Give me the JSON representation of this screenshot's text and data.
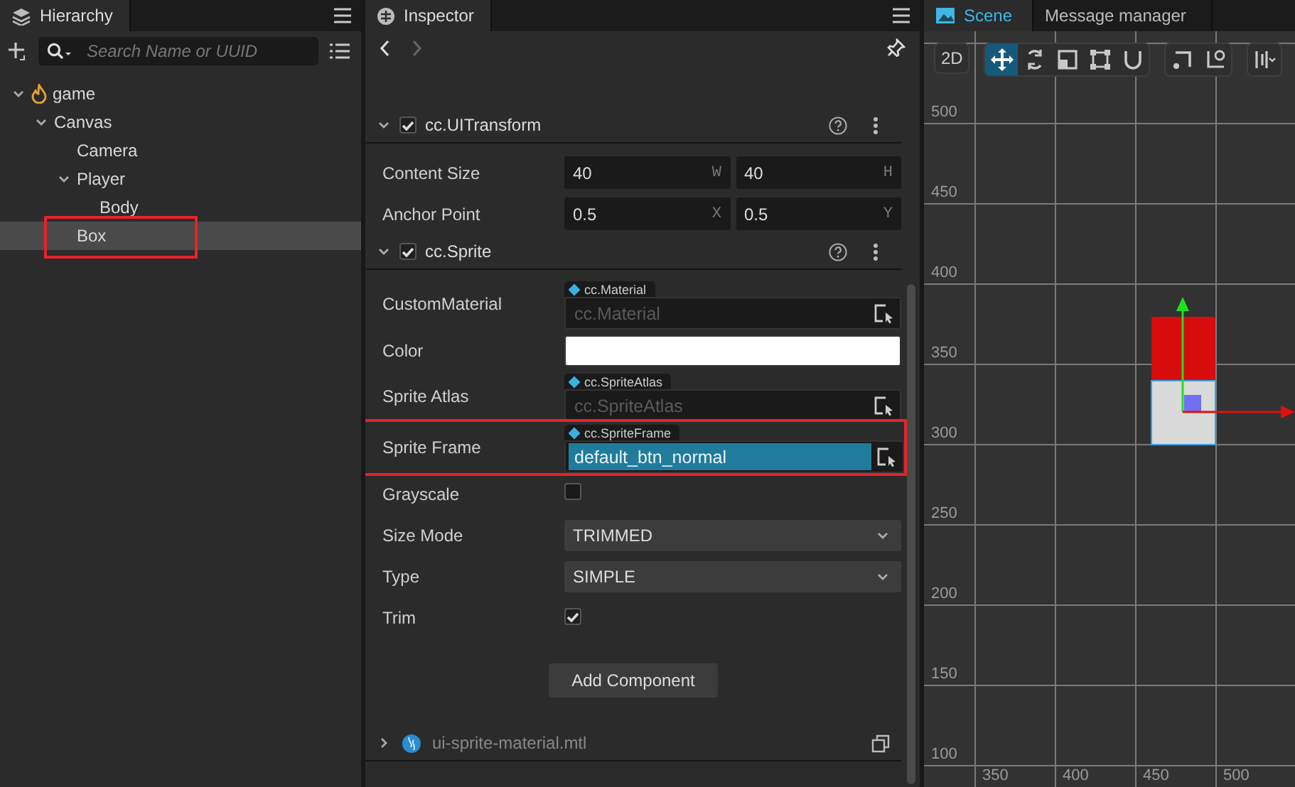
{
  "hierarchy": {
    "tab": "Hierarchy",
    "search": {
      "placeholder": "Search Name or UUID"
    },
    "tree": [
      {
        "name": "game",
        "kind": "scene",
        "expanded": true,
        "selected": false,
        "highlighted": false,
        "children": [
          {
            "name": "Canvas",
            "expanded": true,
            "selected": false,
            "highlighted": false,
            "children": [
              {
                "name": "Camera",
                "selected": false,
                "highlighted": false
              },
              {
                "name": "Player",
                "expanded": true,
                "selected": false,
                "highlighted": false,
                "children": [
                  {
                    "name": "Body",
                    "selected": false,
                    "highlighted": false
                  }
                ]
              },
              {
                "name": "Box",
                "selected": true,
                "highlighted": true
              }
            ]
          }
        ]
      }
    ]
  },
  "inspector": {
    "tab": "Inspector",
    "components": [
      {
        "name": "cc.UITransform",
        "enabled": true,
        "expanded": true,
        "properties": [
          {
            "label": "Content Size",
            "kind": "vec2",
            "highlighted": false,
            "fields": [
              {
                "value": "40",
                "axis": "W"
              },
              {
                "value": "40",
                "axis": "H"
              }
            ]
          },
          {
            "label": "Anchor Point",
            "kind": "vec2",
            "highlighted": false,
            "fields": [
              {
                "value": "0.5",
                "axis": "X"
              },
              {
                "value": "0.5",
                "axis": "Y"
              }
            ]
          }
        ]
      },
      {
        "name": "cc.Sprite",
        "enabled": true,
        "expanded": true,
        "properties": [
          {
            "label": "CustomMaterial",
            "kind": "asset",
            "highlighted": false,
            "type": "cc.Material",
            "placeholder": "cc.Material"
          },
          {
            "label": "Color",
            "kind": "color",
            "highlighted": false,
            "color": "#ffffff"
          },
          {
            "label": "Sprite Atlas",
            "kind": "asset",
            "highlighted": false,
            "type": "cc.SpriteAtlas",
            "placeholder": "cc.SpriteAtlas"
          },
          {
            "label": "Sprite Frame",
            "kind": "asset",
            "highlighted": true,
            "type": "cc.SpriteFrame",
            "value": "default_btn_normal"
          },
          {
            "label": "Grayscale",
            "kind": "checkbox",
            "highlighted": false,
            "checked": false
          },
          {
            "label": "Size Mode",
            "kind": "select",
            "highlighted": false,
            "value": "TRIMMED"
          },
          {
            "label": "Type",
            "kind": "select",
            "highlighted": false,
            "value": "SIMPLE"
          },
          {
            "label": "Trim",
            "kind": "checkbox",
            "highlighted": false,
            "checked": true
          }
        ]
      }
    ],
    "add_button": "Add Component",
    "material": {
      "name": "ui-sprite-material.mtl",
      "expanded": false
    }
  },
  "scene": {
    "tabs": [
      {
        "label": "Scene",
        "selected": true
      },
      {
        "label": "Message manager",
        "selected": false
      }
    ],
    "mode_button": "2D",
    "tool_groups": [
      [
        {
          "kind": "move",
          "selected": true
        },
        {
          "kind": "rotate",
          "selected": false
        },
        {
          "kind": "scale",
          "selected": false
        },
        {
          "kind": "rect",
          "selected": false
        },
        {
          "kind": "snap",
          "selected": false
        }
      ],
      [
        {
          "kind": "pivot",
          "selected": false
        },
        {
          "kind": "local",
          "selected": false
        }
      ],
      [
        {
          "kind": "align",
          "selected": false
        }
      ]
    ],
    "y_ruler": [
      "500",
      "450",
      "400",
      "350",
      "300",
      "250",
      "200",
      "150",
      "100"
    ],
    "x_ruler": [
      "350",
      "400",
      "450",
      "500"
    ]
  }
}
